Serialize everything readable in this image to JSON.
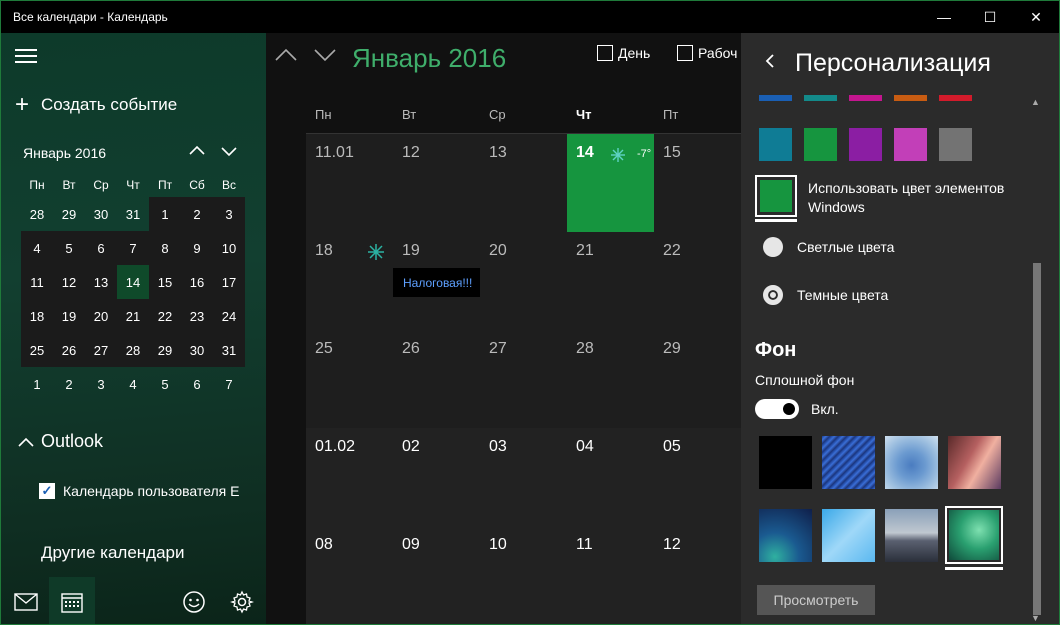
{
  "window": {
    "title": "Все календари - Календарь",
    "controls": [
      "—",
      "☐",
      "✕"
    ]
  },
  "sidebar": {
    "create_label": "Создать событие",
    "mini_month": "Январь 2016",
    "dow": [
      "Пн",
      "Вт",
      "Ср",
      "Чт",
      "Пт",
      "Сб",
      "Вс"
    ],
    "weeks": [
      [
        "28",
        "29",
        "30",
        "31",
        "1",
        "2",
        "3"
      ],
      [
        "4",
        "5",
        "6",
        "7",
        "8",
        "9",
        "10"
      ],
      [
        "11",
        "12",
        "13",
        "14",
        "15",
        "16",
        "17"
      ],
      [
        "18",
        "19",
        "20",
        "21",
        "22",
        "23",
        "24"
      ],
      [
        "25",
        "26",
        "27",
        "28",
        "29",
        "30",
        "31"
      ],
      [
        "1",
        "2",
        "3",
        "4",
        "5",
        "6",
        "7"
      ]
    ],
    "outlook_label": "Outlook",
    "calendar_item": "Календарь пользователя Е",
    "other_calendars": "Другие календари"
  },
  "main": {
    "month_title": "Январь 2016",
    "view_day": "День",
    "view_work": "Рабоч",
    "dow": [
      "Пн",
      "Вт",
      "Ср",
      "Чт",
      "Пт"
    ],
    "weeks": [
      [
        "11.01",
        "12",
        "13",
        "14",
        "15"
      ],
      [
        "18",
        "19",
        "20",
        "21",
        "22"
      ],
      [
        "25",
        "26",
        "27",
        "28",
        "29"
      ],
      [
        "01.02",
        "02",
        "03",
        "04",
        "05"
      ],
      [
        "08",
        "09",
        "10",
        "11",
        "12"
      ]
    ],
    "today_weather": "-7°",
    "event_label": "Налоговая!!!"
  },
  "panel": {
    "title": "Персонализация",
    "use_windows_color": "Использовать цвет элементов Windows",
    "light_label": "Светлые цвета",
    "dark_label": "Темные цвета",
    "background_heading": "Фон",
    "solid_bg_label": "Сплошной фон",
    "toggle_state": "Вкл.",
    "preview_button": "Просмотреть"
  },
  "colors": {
    "accent": "#16953f",
    "top_swatches": [
      "#1a5fb4",
      "#138a8a",
      "#c4168f",
      "#c85c12",
      "#d21b2b"
    ],
    "swatches": [
      "#0f7c95",
      "#16953f",
      "#8b1ea3",
      "#c23fb8",
      "#737373"
    ]
  }
}
